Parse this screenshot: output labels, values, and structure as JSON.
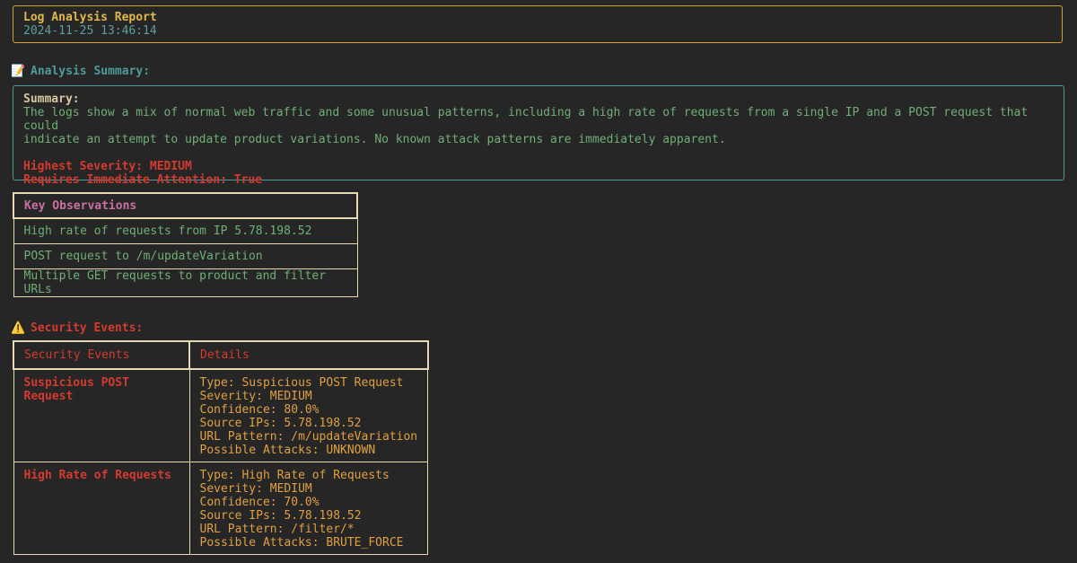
{
  "header": {
    "title": "Log Analysis Report",
    "timestamp": "2024-11-25 13:46:14"
  },
  "analysis": {
    "icon": "memo-icon",
    "heading": "Analysis Summary:",
    "summary_label": "Summary:",
    "summary_line1": "The logs show a mix of normal web traffic and some unusual patterns, including a high rate of requests from a single IP and a POST request that could",
    "summary_line2": "indicate an attempt to update product variations. No known attack patterns are immediately apparent.",
    "highest_severity": "Highest Severity: MEDIUM",
    "requires_attention": "Requires Immediate Attention: True"
  },
  "observations": {
    "header": "Key Observations",
    "items": [
      "High rate of requests from IP 5.78.198.52",
      "POST request to /m/updateVariation",
      "Multiple GET requests to product and filter URLs"
    ]
  },
  "security": {
    "icon": "warning-icon",
    "heading": "Security Events:",
    "columns": [
      "Security Events",
      "Details"
    ],
    "events": [
      {
        "name": "Suspicious POST Request",
        "details": [
          "Type: Suspicious POST Request",
          "Severity: MEDIUM",
          "Confidence: 80.0%",
          "Source IPs: 5.78.198.52",
          "URL Pattern: /m/updateVariation",
          "Possible Attacks: UNKNOWN"
        ]
      },
      {
        "name": "High Rate of Requests",
        "details": [
          "Type: High Rate of Requests",
          "Severity: MEDIUM",
          "Confidence: 70.0%",
          "Source IPs: 5.78.198.52",
          "URL Pattern: /filter/*",
          "Possible Attacks: BRUTE_FORCE"
        ]
      }
    ]
  },
  "colors": {
    "background": "#262626",
    "header_border": "#d4a233",
    "summary_border": "#4f9a9a",
    "severity": "#d43a2f",
    "observation_text": "#6fae74",
    "details_text": "#e0a040"
  }
}
